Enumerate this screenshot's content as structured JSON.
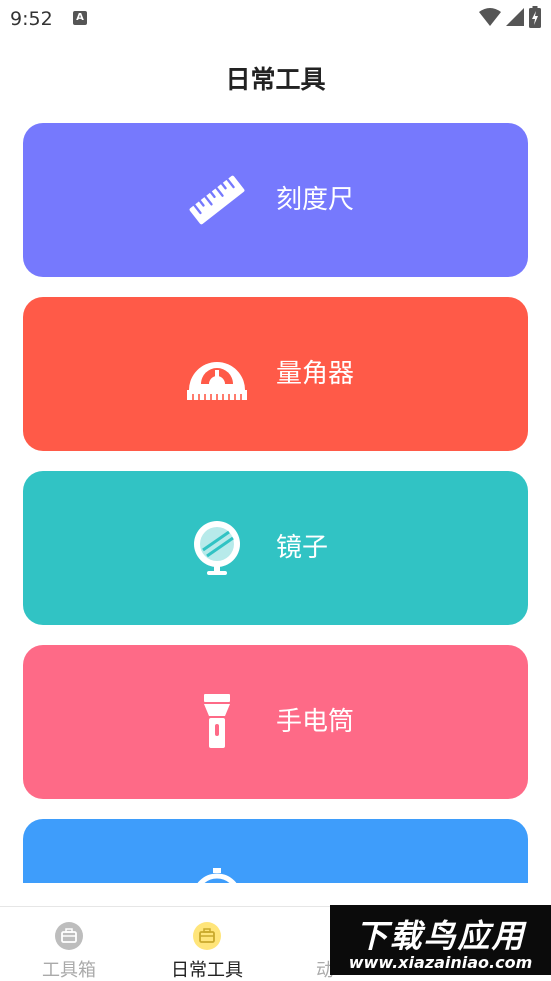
{
  "status": {
    "time": "9:52",
    "indicator": "A"
  },
  "page_title": "日常工具",
  "tools": [
    {
      "label": "刻度尺",
      "icon": "ruler-icon",
      "color": "#7679FD"
    },
    {
      "label": "量角器",
      "icon": "protractor-icon",
      "color": "#FF5A48"
    },
    {
      "label": "镜子",
      "icon": "mirror-icon",
      "color": "#31C3C4"
    },
    {
      "label": "手电筒",
      "icon": "flashlight-icon",
      "color": "#FE6A87"
    },
    {
      "label": "",
      "icon": "stopwatch-icon",
      "color": "#3E9DFB"
    }
  ],
  "nav": {
    "items": [
      {
        "label": "工具箱",
        "icon": "toolbox-icon",
        "active": false
      },
      {
        "label": "日常工具",
        "icon": "toolbox-icon",
        "active": true
      },
      {
        "label": "动",
        "icon": "",
        "active": false
      }
    ],
    "active_color": "#FFE57A",
    "inactive_color": "#BDBDBD"
  },
  "watermark": {
    "main": "下载鸟应用",
    "url": "www.xiazainiao.com"
  }
}
